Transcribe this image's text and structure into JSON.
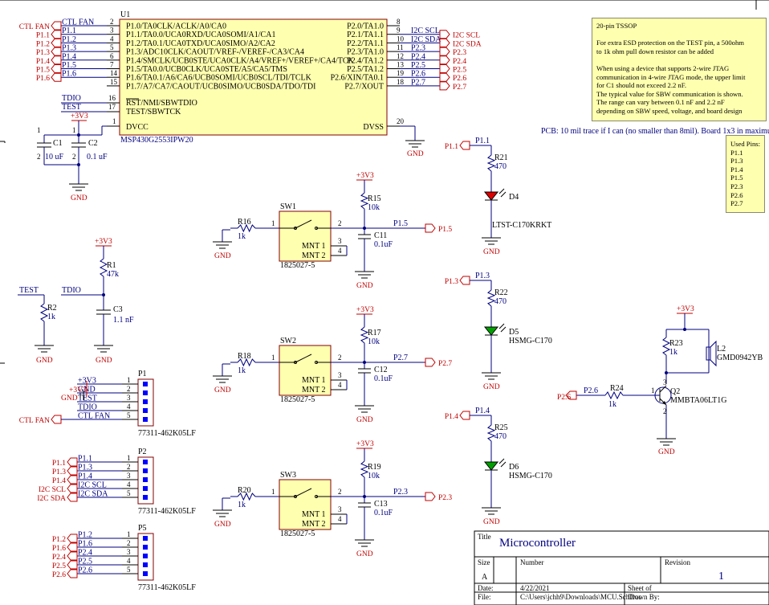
{
  "mcu": {
    "ref": "U1",
    "part": "MSP430G2553IPW20",
    "pins_left": [
      {
        "num": "2",
        "name": "P1.0/TA0CLK/ACLK/A0/CA0"
      },
      {
        "num": "3",
        "name": "P1.1/TA0.0/UCA0RXD/UCA0SOMI/A1/CA1"
      },
      {
        "num": "4",
        "name": "P1.2/TA0.1/UCA0TXD/UCA0SIMO/A2/CA2"
      },
      {
        "num": "5",
        "name": "P1.3/ADC10CLK/CAOUT/VREF-/VEREF-/CA3/CA4"
      },
      {
        "num": "6",
        "name": "P1.4/SMCLK/UCB0STE/UCA0CLK/A4/VREF+/VEREF+/CA4/TCK"
      },
      {
        "num": "7",
        "name": "P1.5/TA0.0/UCB0CLK/UCA0STE/A5/CA5/TMS"
      },
      {
        "num": "14",
        "name": "P1.6/TA0.1/A6/CA6/UCB0SOMI/UCB0SCL/TDI/TCLK"
      },
      {
        "num": "15",
        "name": "P1.7/A7/CA7/CAOUT/UCB0SIMO/UCB0SDA/TDO/TDI"
      }
    ],
    "pins_right": [
      {
        "num": "8",
        "name": "P2.0/TA1.0"
      },
      {
        "num": "9",
        "name": "P2.1/TA1.1"
      },
      {
        "num": "10",
        "name": "P2.2/TA1.1"
      },
      {
        "num": "11",
        "name": "P2.3/TA1.0"
      },
      {
        "num": "12",
        "name": "P2.4/TA1.2"
      },
      {
        "num": "13",
        "name": "P2.5/TA1.2"
      },
      {
        "num": "19",
        "name": "P2.6/XIN/TA0.1"
      },
      {
        "num": "18",
        "name": "P2.7/XOUT"
      }
    ],
    "pins_misc": [
      {
        "num": "16",
        "name": "RST/NMI/SBWTDIO"
      },
      {
        "num": "17",
        "name": "TEST/SBWTCK"
      },
      {
        "num": "1",
        "name": "DVCC"
      },
      {
        "num": "20",
        "name": "DVSS"
      }
    ]
  },
  "left_ports": [
    "CTL FAN",
    "P1.1",
    "P1.2",
    "P1.3",
    "P1.4",
    "P1.5",
    "P1.6"
  ],
  "left_nets": [
    "CTL FAN",
    "P1.1",
    "P1.2",
    "P1.3",
    "P1.4",
    "P1.5",
    "P1.6"
  ],
  "right_nets": [
    "I2C SCL",
    "I2C SDA",
    "P2.3",
    "P2.4",
    "P2.5",
    "P2.6",
    "P2.7"
  ],
  "right_ports": [
    "I2C SCL",
    "I2C SDA",
    "P2.3",
    "P2.4",
    "P2.5",
    "P2.6",
    "P2.7"
  ],
  "misc_nets": {
    "tdio": "TDIO",
    "test": "TEST"
  },
  "power": {
    "v33": "+3V3",
    "gnd": "GND"
  },
  "caps_top": [
    {
      "ref": "C1",
      "value": "10 uF"
    },
    {
      "ref": "C2",
      "value": "0.1 uF"
    }
  ],
  "reset": {
    "r1_ref": "R1",
    "r1_value": "47k",
    "r2_ref": "R2",
    "r2_value": "1k",
    "c3_ref": "C3",
    "c3_value": "1.1 nF",
    "test_net": "TEST",
    "tdio_net": "TDIO"
  },
  "switches": [
    {
      "sw": "SW1",
      "part": "1825027-5",
      "mnt1": "MNT 1",
      "mnt2": "MNT 2",
      "rin_ref": "R16",
      "rin_value": "1k",
      "rpu_ref": "R15",
      "rpu_value": "10k",
      "cap_ref": "C11",
      "cap_value": "0.1uF",
      "net": "P1.5"
    },
    {
      "sw": "SW2",
      "part": "1825027-5",
      "mnt1": "MNT 1",
      "mnt2": "MNT 2",
      "rin_ref": "R18",
      "rin_value": "1k",
      "rpu_ref": "R17",
      "rpu_value": "10k",
      "cap_ref": "C12",
      "cap_value": "0.1uF",
      "net": "P2.7"
    },
    {
      "sw": "SW3",
      "part": "1825027-5",
      "mnt1": "MNT 1",
      "mnt2": "MNT 2",
      "rin_ref": "R20",
      "rin_value": "1k",
      "rpu_ref": "R19",
      "rpu_value": "10k",
      "cap_ref": "C13",
      "cap_value": "0.1uF",
      "net": "P2.3"
    }
  ],
  "leds": [
    {
      "net": "P1.1",
      "r_ref": "R21",
      "r_value": "470",
      "d_ref": "D4",
      "d_part": "LTST-C170KRKT",
      "color": "#e00000"
    },
    {
      "net": "P1.3",
      "r_ref": "R22",
      "r_value": "470",
      "d_ref": "D5",
      "d_part": "HSMG-C170",
      "color": "#00a000"
    },
    {
      "net": "P1.4",
      "r_ref": "R25",
      "r_value": "470",
      "d_ref": "D6",
      "d_part": "HSMG-C170",
      "color": "#00a000"
    }
  ],
  "buzzer": {
    "net": "P2.6",
    "r24_ref": "R24",
    "r24_value": "1k",
    "r23_ref": "R23",
    "r23_value": "1k",
    "q_ref": "Q2",
    "q_part": "MMBTA06LT1G",
    "l_ref": "L2",
    "l_part": "GMD0942YB"
  },
  "connectors": [
    {
      "ref": "P1",
      "part": "77311-462K05LF",
      "nets": [
        "+3V3",
        "GND",
        "TEST",
        "TDIO",
        "CTL FAN"
      ],
      "ports": [
        "CTL FAN"
      ]
    },
    {
      "ref": "P2",
      "part": "77311-462K05LF",
      "nets": [
        "P1.1",
        "P1.3",
        "P1.4",
        "I2C SCL",
        "I2C SDA"
      ],
      "ports": [
        "P1.1",
        "P1.3",
        "P1.4",
        "I2C SCL",
        "I2C SDA"
      ]
    },
    {
      "ref": "P5",
      "part": "77311-462K05LF",
      "nets": [
        "P1.2",
        "P1.6",
        "P2.4",
        "P2.5",
        "P2.6"
      ],
      "ports": [
        "P1.2",
        "P1.6",
        "P2.4",
        "P2.5",
        "P2.6"
      ]
    }
  ],
  "pin_numbers": [
    "1",
    "2",
    "3",
    "4",
    "5"
  ],
  "note_tssop": {
    "lines": [
      "20-pin TSSOP",
      "",
      "For extra ESD protection on the TEST pin, a 500ohm",
      "to 1k ohm pull down resistor can be added",
      "",
      "When using a device that supports 2-wire JTAG",
      "communication in 4-wire JTAG mode, the upper limit",
      "for C1 should not exceed 2.2 nF.",
      "The typical value for SBW communication is shown.",
      "The range can vary between 0.1 nF and 2.2 nF",
      "depending on SBW speed, voltage, and board design"
    ]
  },
  "pcb_note": "PCB: 10 mil trace if I can (no smaller than 8mil). Board 1x3 in maximum",
  "used_pins": {
    "lines": [
      "Used Pins:",
      "P1.1",
      "P1.3",
      "P1.4",
      "P1.5",
      "P2.3",
      "P2.6",
      "P2.7"
    ]
  },
  "title_block": {
    "title_label": "Title",
    "title": "Microcontroller",
    "size_label": "Size",
    "size": "A",
    "number_label": "Number",
    "revision_label": "Revision",
    "revision": "1",
    "date_label": "Date:",
    "date": "4/22/2021",
    "sheet_label": "Sheet   of",
    "file_label": "File:",
    "file": "C:\\Users\\jchh9\\Downloads\\MCU.SchDoc",
    "drawn_label": "Drawn By:"
  }
}
